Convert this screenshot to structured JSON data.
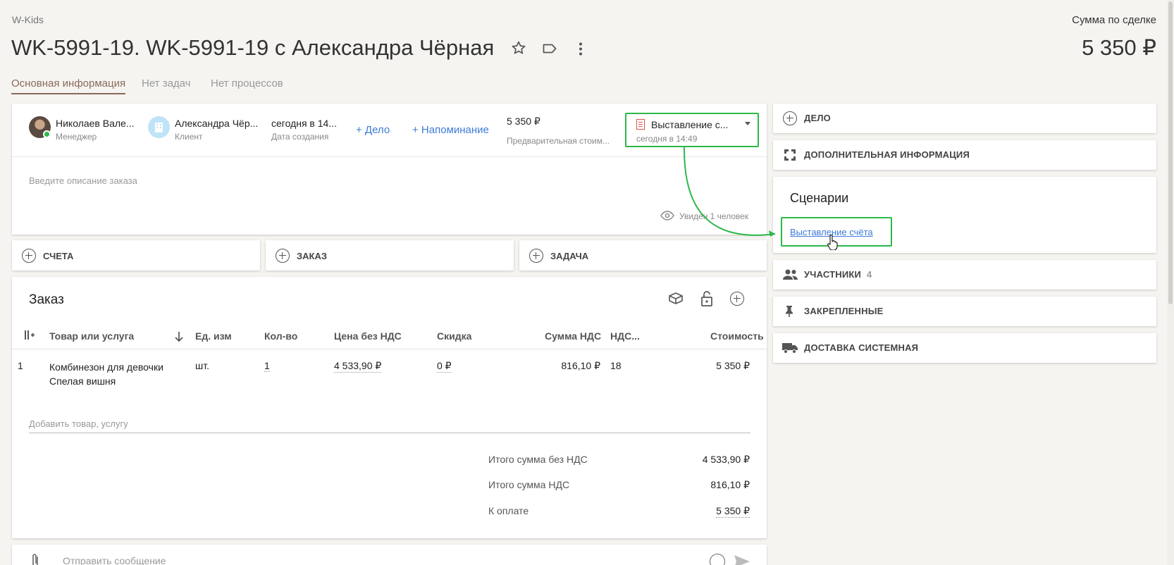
{
  "header": {
    "company": "W-Kids",
    "title": "WK-5991-19. WK-5991-19 с Александра Чёрная",
    "deal_sum_label": "Сумма по сделке",
    "deal_sum_value": "5 350 ₽"
  },
  "tabs": [
    {
      "label": "Основная информация",
      "active": true
    },
    {
      "label": "Нет задач",
      "active": false
    },
    {
      "label": "Нет процессов",
      "active": false
    }
  ],
  "summary": {
    "manager_name": "Николаев Вале...",
    "manager_role": "Менеджер",
    "client_name": "Александра Чёр...",
    "client_role": "Клиент",
    "created_value": "сегодня в 14...",
    "created_label": "Дата создания",
    "add_case": "+ Дело",
    "add_reminder": "+ Напоминание",
    "price_value": "5 350 ₽",
    "price_label": "Предварительная стоим...",
    "stage_name": "Выставление с...",
    "stage_time": "сегодня в 14:49",
    "description_placeholder": "Введите описание заказа",
    "seen_by": "Увиден 1 человек"
  },
  "actions": {
    "invoices": "СЧЕТА",
    "order": "ЗАКАЗ",
    "task": "ЗАДАЧА"
  },
  "order": {
    "title": "Заказ",
    "columns": {
      "product": "Товар или услуга",
      "unit": "Ед. изм",
      "qty": "Кол-во",
      "price": "Цена без НДС",
      "discount": "Скидка",
      "vat_sum": "Сумма НДС",
      "vat_rate": "НДС...",
      "cost": "Стоимость"
    },
    "rows": [
      {
        "num": "1",
        "product_line1": "Комбинезон для девочки",
        "product_line2": "Спелая вишня",
        "unit": "шт.",
        "qty": "1",
        "price": "4 533,90 ₽",
        "discount": "0 ₽",
        "vat_sum": "816,10 ₽",
        "vat_rate": "18",
        "cost": "5 350 ₽"
      }
    ],
    "add_placeholder": "Добавить товар, услугу",
    "totals": {
      "no_vat_label": "Итого сумма без НДС",
      "no_vat_value": "4 533,90 ₽",
      "vat_label": "Итого сумма НДС",
      "vat_value": "816,10 ₽",
      "pay_label": "К оплате",
      "pay_value": "5 350 ₽"
    }
  },
  "message": {
    "placeholder": "Отправить сообщение"
  },
  "sidebar": {
    "case": "ДЕЛО",
    "extra_info": "ДОПОЛНИТЕЛЬНАЯ ИНФОРМАЦИЯ",
    "scenarios_title": "Сценарии",
    "scenario_link": "Выставление счёта",
    "participants": "УЧАСТНИКИ",
    "participants_count": "4",
    "pinned": "ЗАКРЕПЛЕННЫЕ",
    "delivery": "ДОСТАВКА СИСТЕМНАЯ"
  },
  "colors": {
    "highlight": "#2db84a",
    "link": "#3d7bd6",
    "tab_active": "#8a6a5c"
  }
}
